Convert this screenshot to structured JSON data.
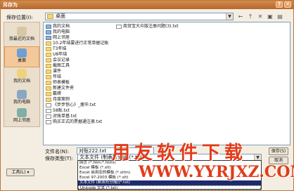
{
  "window": {
    "title": "另存为"
  },
  "save_in": {
    "label": "保存位置(I):",
    "value": "桌面"
  },
  "places": [
    {
      "label": "我最近的文档",
      "icon": "recent-docs-icon"
    },
    {
      "label": "桌面",
      "icon": "desktop-icon"
    },
    {
      "label": "我的文档",
      "icon": "my-documents-icon"
    },
    {
      "label": "我的电脑",
      "icon": "my-computer-icon"
    },
    {
      "label": "网上邻居",
      "icon": "network-places-icon"
    }
  ],
  "files_col1": [
    {
      "name": "我的文档",
      "kind": "special"
    },
    {
      "name": "我的电脑",
      "kind": "special"
    },
    {
      "name": "网上邻居",
      "kind": "special"
    },
    {
      "name": "10.2年结要进行正常单据记账",
      "kind": "folder"
    },
    {
      "name": "T3年结",
      "kind": "folder"
    },
    {
      "name": "U8年结",
      "kind": "folder"
    },
    {
      "name": "会议记录",
      "kind": "folder"
    },
    {
      "name": "截图工具",
      "kind": "folder"
    },
    {
      "name": "课件",
      "kind": "folder"
    },
    {
      "name": "年结",
      "kind": "folder"
    },
    {
      "name": "师表模板",
      "kind": "folder"
    },
    {
      "name": "新建文件夹",
      "kind": "folder"
    },
    {
      "name": "戴嵘",
      "kind": "folder"
    },
    {
      "name": "月度案例",
      "kind": "folder"
    },
    {
      "name": "《步步惊心》_瘦毕.txt",
      "kind": "file"
    },
    {
      "name": "58账.txt",
      "kind": "file"
    },
    {
      "name": "对账单基.txt",
      "kind": "file"
    },
    {
      "name": "购买正式的票据通注册.txt",
      "kind": "file"
    }
  ],
  "files_col2": [
    {
      "name": "商贸宝大众版注册问题(3).txt",
      "kind": "file"
    }
  ],
  "filename": {
    "label": "文件名(N):",
    "value": "对账222.txt"
  },
  "filetype": {
    "label": "保存类型(T):",
    "value": "文本文件 (制表符分隔)(*.txt)"
  },
  "dropdown_options": [
    "网页 (*.htm;*.html)",
    "Excel 模板 (*.xlt)",
    "Excel 启用宏的模板 (*.xltm)",
    "Excel 97-2003 模板 (*.xlt)",
    "文本文件 (制表符分隔)(*.txt)",
    "Unicode 文本 (*.txt)"
  ],
  "tools_label": "工具(L) ▾",
  "buttons": {
    "save": "保存(S)",
    "cancel": "取消"
  },
  "watermark": {
    "title": "用友软件下载",
    "url": "WWW.YYRJXZ.COM"
  }
}
